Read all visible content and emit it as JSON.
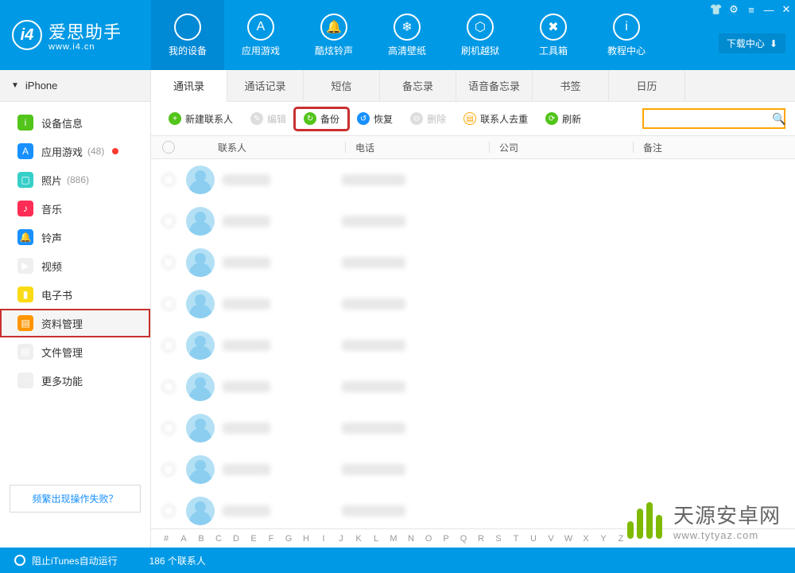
{
  "brand": {
    "name": "爱思助手",
    "domain": "www.i4.cn"
  },
  "window_buttons": {
    "shirt": "👕",
    "gear": "⚙",
    "menu": "≡",
    "min": "—",
    "close": "✕"
  },
  "download_center": "下载中心",
  "top_nav": [
    {
      "label": "我的设备",
      "icon": ""
    },
    {
      "label": "应用游戏",
      "icon": "A"
    },
    {
      "label": "酷炫铃声",
      "icon": "🔔"
    },
    {
      "label": "高清壁纸",
      "icon": "❄"
    },
    {
      "label": "刷机越狱",
      "icon": "⬡"
    },
    {
      "label": "工具箱",
      "icon": "✖"
    },
    {
      "label": "教程中心",
      "icon": "i"
    }
  ],
  "sub_tabs": [
    "通讯录",
    "通话记录",
    "短信",
    "备忘录",
    "语音备忘录",
    "书签",
    "日历"
  ],
  "device": {
    "name": "iPhone"
  },
  "sidebar": [
    {
      "label": "设备信息",
      "color": "ic-green",
      "icon": "i"
    },
    {
      "label": "应用游戏",
      "color": "ic-blue",
      "icon": "A",
      "count": "(48)",
      "dot": true
    },
    {
      "label": "照片",
      "color": "ic-cyan",
      "icon": "▢",
      "count": "(886)"
    },
    {
      "label": "音乐",
      "color": "ic-pink",
      "icon": "♪"
    },
    {
      "label": "铃声",
      "color": "ic-blue",
      "icon": "🔔"
    },
    {
      "label": "视频",
      "color": "ic-gray",
      "icon": "▶"
    },
    {
      "label": "电子书",
      "color": "ic-yellow",
      "icon": "▮"
    },
    {
      "label": "资料管理",
      "color": "ic-orange",
      "icon": "▤",
      "selected": true
    },
    {
      "label": "文件管理",
      "color": "ic-gray",
      "icon": "▤"
    },
    {
      "label": "更多功能",
      "color": "ic-gray",
      "icon": "⋯"
    }
  ],
  "help_link": "频繁出现操作失败？",
  "toolbar": {
    "new": "新建联系人",
    "edit": "编辑",
    "backup": "备份",
    "restore": "恢复",
    "delete": "删除",
    "dedupe": "联系人去重",
    "refresh": "刷新"
  },
  "table": {
    "headers": {
      "contact": "联系人",
      "phone": "电话",
      "company": "公司",
      "notes": "备注"
    },
    "row_count": 9
  },
  "alpha": [
    "#",
    "A",
    "B",
    "C",
    "D",
    "E",
    "F",
    "G",
    "H",
    "I",
    "J",
    "K",
    "L",
    "M",
    "N",
    "O",
    "P",
    "Q",
    "R",
    "S",
    "T",
    "U",
    "V",
    "W",
    "X",
    "Y",
    "Z"
  ],
  "status": {
    "left": "阻止iTunes自动运行",
    "count": "186 个联系人"
  },
  "watermark": {
    "main": "天源安卓网",
    "sub": "www.tytyaz.com"
  }
}
